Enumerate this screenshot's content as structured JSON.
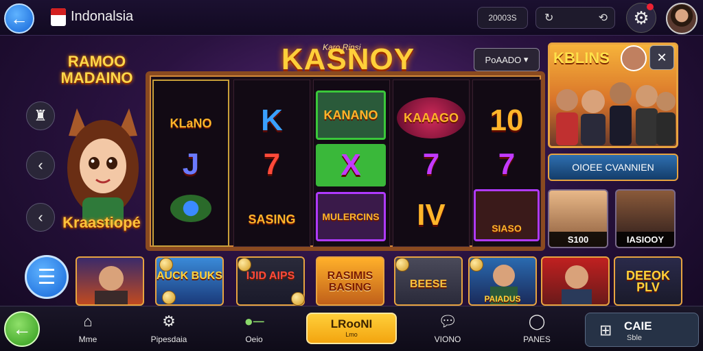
{
  "header": {
    "title": "Indonalsia",
    "coins_label": "20003S",
    "back_icon": "arrow-left-icon",
    "search_left_icon": "refresh-icon",
    "search_right_icon": "sync-icon",
    "settings_icon": "gear-icon",
    "notification_color": "#e22233"
  },
  "left": {
    "promo_title": "RAMOO MADAINO",
    "mascot_label": "Kraastiopé",
    "side_icons": [
      "chef-hat-icon",
      "chevron-left-icon",
      "chevron-left-icon"
    ]
  },
  "slot": {
    "title": "KASNOY",
    "subtitle": "Karo Rinsi",
    "paylines_label": "PoAADO",
    "reels": [
      [
        "KLaNO",
        "J",
        "gem"
      ],
      [
        "K",
        "7",
        "SASING"
      ],
      [
        "KANANO",
        "X",
        "MULERCINS"
      ],
      [
        "KAAAGO",
        "7",
        "IV"
      ],
      [
        "10",
        "7",
        "SIASO"
      ]
    ]
  },
  "promo_panel": {
    "title": "KBLINS",
    "claim_label": "OIOEE CVANNIEN",
    "cards": [
      {
        "caption": "S100"
      },
      {
        "caption": "IASIOOY"
      }
    ]
  },
  "games": [
    {
      "title": "",
      "kind": "portrait"
    },
    {
      "title": "AUCK BUKS",
      "kind": "text"
    },
    {
      "title": "IJID AIPS",
      "kind": "text"
    },
    {
      "title": "RASIMIS BASING",
      "kind": "text"
    },
    {
      "title": "BEESE",
      "kind": "text"
    },
    {
      "title": "PAIADUS",
      "kind": "portrait"
    },
    {
      "title": "",
      "kind": "portrait"
    },
    {
      "title": "DEEOK PLV",
      "kind": "text"
    }
  ],
  "nav": {
    "items": [
      {
        "label": "Mme",
        "icon": "home-icon"
      },
      {
        "label": "Pipesdaia",
        "icon": "gear-icon"
      },
      {
        "label": "Oeio",
        "icon": "controller-icon"
      },
      {
        "label": "VIONO",
        "icon": "chat-icon"
      },
      {
        "label": "PANES",
        "icon": "bubble-icon"
      }
    ],
    "play_label": "LRooNI",
    "play_sub": "Lmo",
    "cashier_label": "CAIE",
    "cashier_sub": "Sble",
    "cashier_icon": "gift-icon"
  }
}
